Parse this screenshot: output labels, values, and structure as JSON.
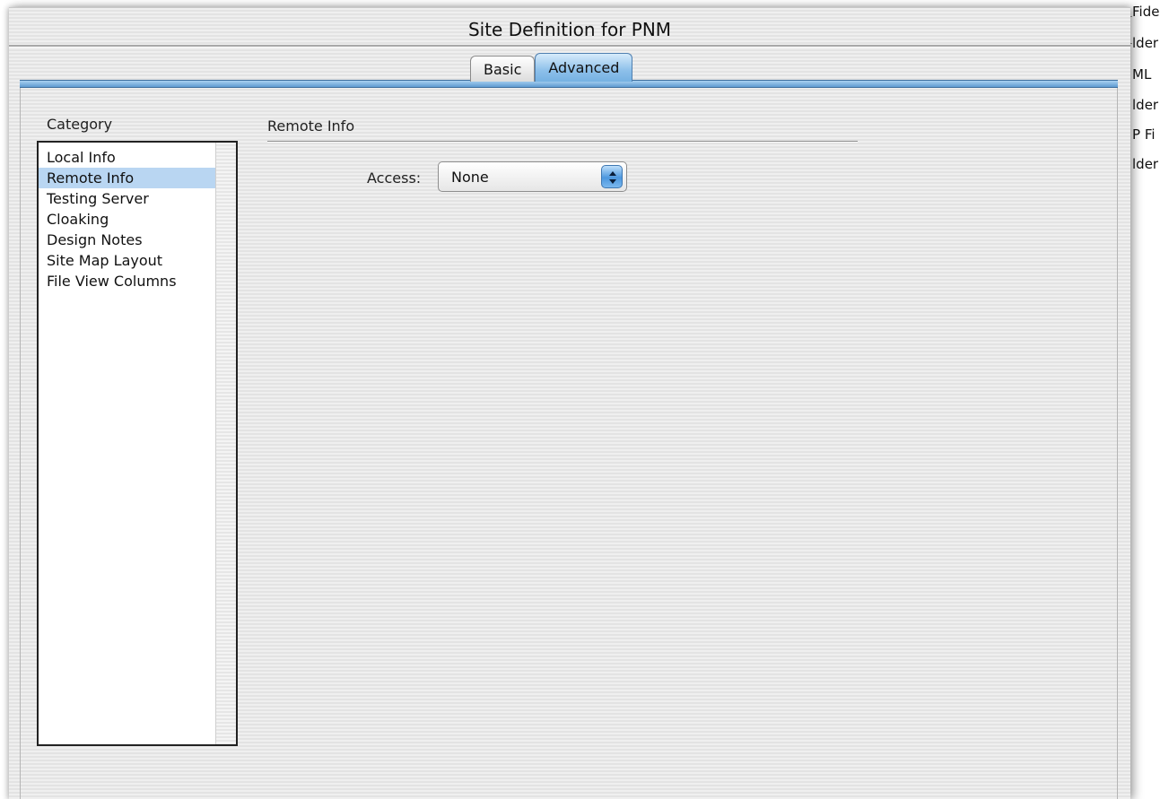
{
  "dialog": {
    "title": "Site Definition for PNM",
    "tabs": [
      {
        "label": "Basic",
        "active": false
      },
      {
        "label": "Advanced",
        "active": true
      }
    ]
  },
  "category": {
    "label": "Category",
    "items": [
      {
        "label": "Local Info",
        "selected": false
      },
      {
        "label": "Remote Info",
        "selected": true
      },
      {
        "label": "Testing Server",
        "selected": false
      },
      {
        "label": "Cloaking",
        "selected": false
      },
      {
        "label": "Design Notes",
        "selected": false
      },
      {
        "label": "Site Map Layout",
        "selected": false
      },
      {
        "label": "File View Columns",
        "selected": false
      }
    ]
  },
  "panel": {
    "title": "Remote Info",
    "access": {
      "label": "Access:",
      "value": "None"
    }
  },
  "background_window": {
    "lines": [
      "Fider",
      "lder",
      "ML",
      "lder",
      "P Fi",
      "lder"
    ]
  },
  "colors": {
    "accent": "#75b1e2",
    "selection": "#b9d6f2"
  },
  "icons": {
    "select_arrows": "up-down-arrows-icon"
  }
}
